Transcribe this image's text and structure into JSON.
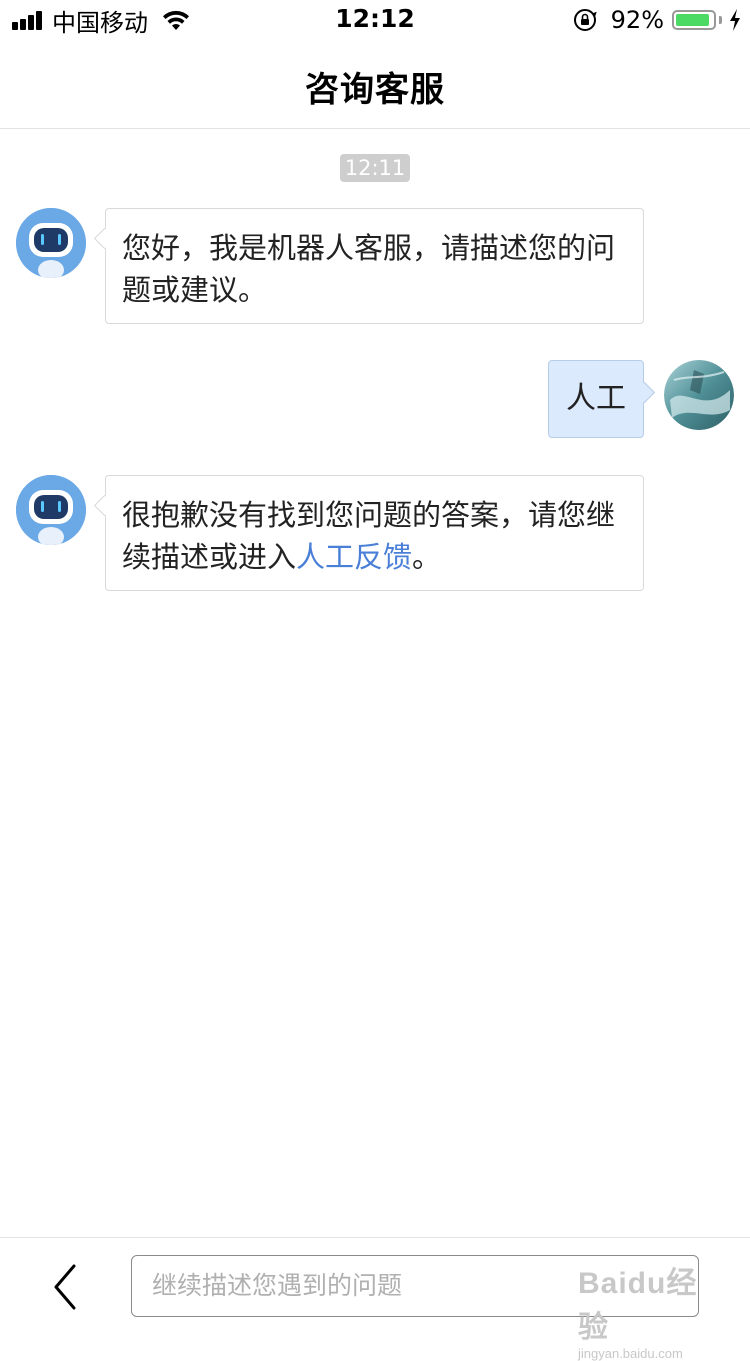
{
  "status_bar": {
    "carrier": "中国移动",
    "time": "12:12",
    "battery_text": "92%",
    "battery_level": 0.92,
    "battery_color": "#4cd964"
  },
  "nav": {
    "title": "咨询客服"
  },
  "chat": {
    "timestamp": "12:11",
    "messages": [
      {
        "sender": "bot",
        "text": "您好，我是机器人客服，请描述您的问题或建议。"
      },
      {
        "sender": "user",
        "text": "人工"
      },
      {
        "sender": "bot",
        "text_before_link": "很抱歉没有找到您问题的答案，请您继续描述或进入",
        "link_text": "人工反馈",
        "text_after_link": "。"
      }
    ]
  },
  "input_bar": {
    "placeholder": "继续描述您遇到的问题"
  },
  "watermark": {
    "main": "Baidu经验",
    "sub": "jingyan.baidu.com"
  },
  "colors": {
    "user_bubble": "#dbeafc",
    "link": "#4a7fd8",
    "bot_avatar": "#6aa8e6"
  },
  "icons": [
    "signal-icon",
    "wifi-icon",
    "orientation-lock-icon",
    "battery-icon",
    "charging-bolt-icon",
    "robot-avatar-icon",
    "user-avatar-icon",
    "back-chevron-icon"
  ]
}
